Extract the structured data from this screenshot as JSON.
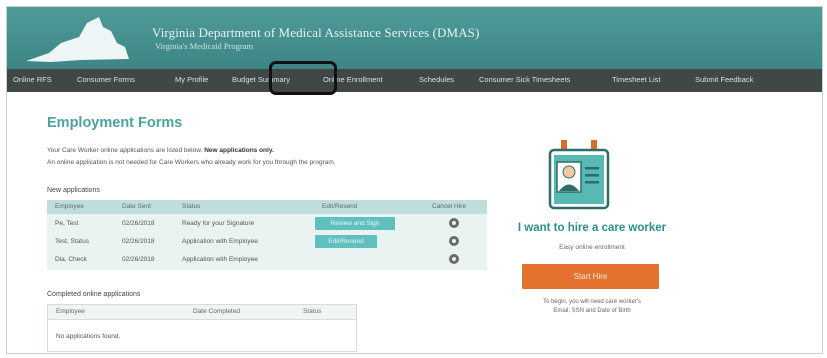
{
  "header": {
    "title": "Virginia Department of Medical Assistance Services (DMAS)",
    "subtitle": "Virginia's Medicaid Program"
  },
  "nav": {
    "items": [
      "Online RFS",
      "Consumer Forms",
      "My Profile",
      "Budget Summary",
      "Online Enrollment",
      "Schedules",
      "Consumer Sick Timesheets",
      "Timesheet List",
      "Submit Feedback"
    ]
  },
  "main": {
    "title": "Employment Forms",
    "intro_line1": "Your Care Worker online applications are listed below.",
    "intro_line1_bold": "New applications only.",
    "intro_line2": "An online application is not needed for Care Workers who already work for you through the program.",
    "new_label": "New applications",
    "new_table": {
      "headers": [
        "Employee",
        "Date Sent",
        "Status",
        "Edit/Resend",
        "Cancel Hire"
      ],
      "rows": [
        {
          "employee": "Pe, Test",
          "date": "02/26/2018",
          "status": "Ready for your Signature",
          "action": "Review and Sign"
        },
        {
          "employee": "Test, Status",
          "date": "02/26/2018",
          "status": "Application with Employee",
          "action": "Edit/Resend"
        },
        {
          "employee": "Dia, Check",
          "date": "02/26/2018",
          "status": "Application with Employee",
          "action": ""
        }
      ]
    },
    "completed_label": "Completed online applications",
    "completed_table": {
      "headers": [
        "Employee",
        "Date Completed",
        "Status"
      ],
      "empty_text": "No applications found."
    }
  },
  "hire": {
    "heading": "I want to hire a care worker",
    "subheading": "Easy online enrollment",
    "button": "Start Hire",
    "note_line1": "To begin, you will need care worker's",
    "note_line2": "Email, SSN and Date of Birth"
  },
  "colors": {
    "header_teal": "#4e9c9a",
    "nav_dark": "#404747",
    "accent_teal": "#4aa39e",
    "table_bg": "#e8f3f2",
    "button_teal": "#5fc0bd",
    "start_orange": "#e2722e"
  }
}
